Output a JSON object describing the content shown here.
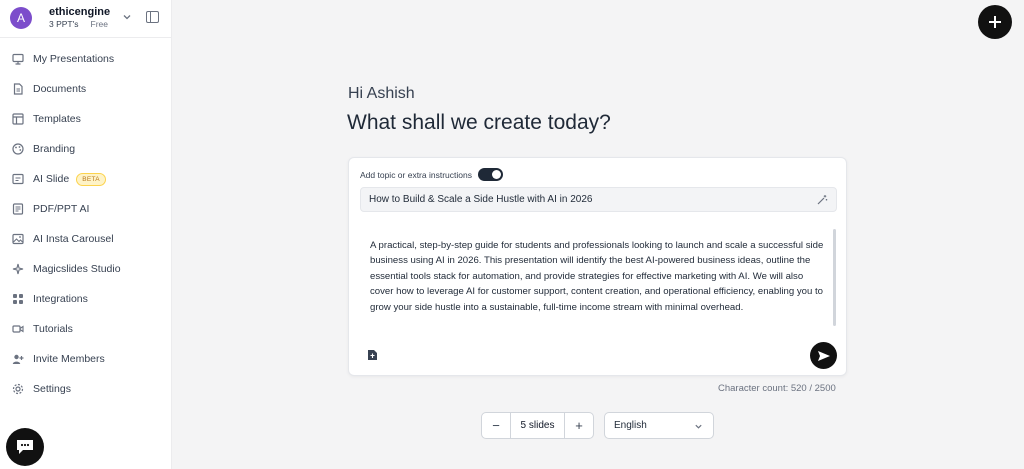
{
  "account": {
    "initial": "A",
    "name": "ethicengine",
    "ppt_count": "3 PPT's",
    "plan": "Free"
  },
  "sidebar": {
    "items": [
      {
        "label": "My Presentations",
        "icon": "presentation-icon"
      },
      {
        "label": "Documents",
        "icon": "document-icon"
      },
      {
        "label": "Templates",
        "icon": "template-icon"
      },
      {
        "label": "Branding",
        "icon": "palette-icon"
      },
      {
        "label": "AI Slide",
        "icon": "ai-slide-icon",
        "badge": "BETA"
      },
      {
        "label": "PDF/PPT AI",
        "icon": "pdf-icon"
      },
      {
        "label": "AI Insta Carousel",
        "icon": "image-icon"
      },
      {
        "label": "Magicslides Studio",
        "icon": "sparkles-icon"
      },
      {
        "label": "Integrations",
        "icon": "grid-icon"
      },
      {
        "label": "Tutorials",
        "icon": "video-icon"
      },
      {
        "label": "Invite Members",
        "icon": "user-plus-icon"
      },
      {
        "label": "Settings",
        "icon": "gear-icon"
      }
    ]
  },
  "main": {
    "greeting": "Hi Ashish",
    "headline": "What shall we create today?",
    "toggle_label": "Add topic or extra instructions",
    "toggle_on": true,
    "topic_value": "How to Build & Scale a Side Hustle with AI in 2026",
    "description": "A practical, step-by-step guide for students and professionals looking to launch and scale a successful side business using AI in 2026. This presentation will identify the best AI-powered business ideas, outline the essential tools stack for automation, and provide strategies for effective marketing with AI. We will also cover how to leverage AI for customer support, content creation, and operational efficiency, enabling you to grow your side hustle into a sustainable, full-time income stream with minimal overhead.",
    "char_count": "Character count: 520 / 2500",
    "slides_value": "5 slides",
    "minus_label": "−",
    "plus_label": "+",
    "language": "English"
  },
  "colors": {
    "avatar": "#7c4dcb",
    "dark": "#111111",
    "beta_text": "#b7791f",
    "beta_bg": "#fef3c7"
  }
}
